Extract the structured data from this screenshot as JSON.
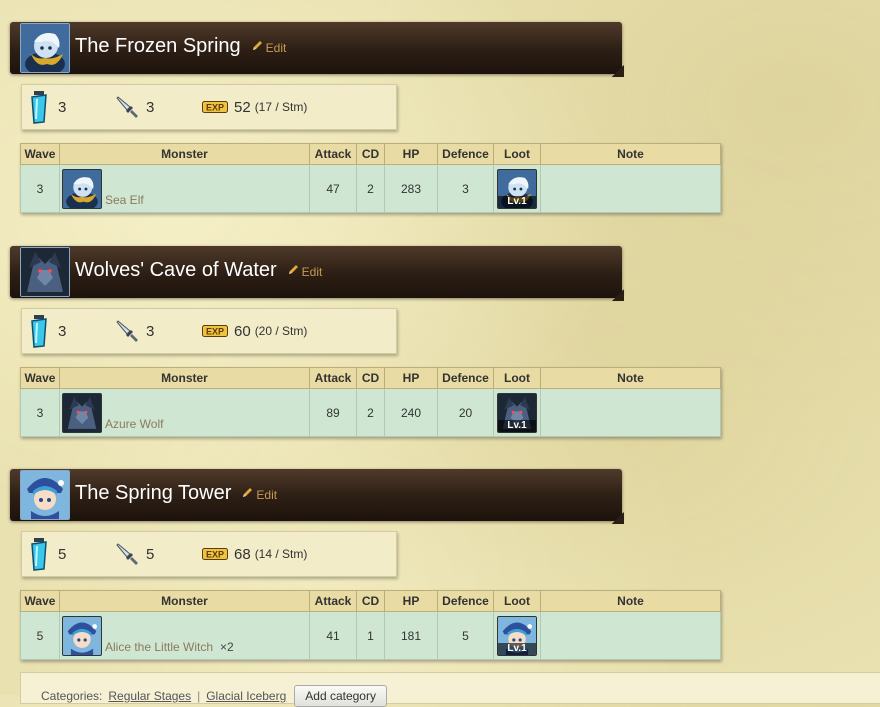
{
  "edit_label": "Edit",
  "columns": [
    "Wave",
    "Monster",
    "Attack",
    "CD",
    "HP",
    "Defence",
    "Loot",
    "Note"
  ],
  "stages": [
    {
      "title": "The Frozen Spring",
      "icon": "sea-elf-icon",
      "stamina": "3",
      "battles": "3",
      "exp": "52",
      "exp_rate": "(17 / Stm)",
      "row": {
        "wave": "3",
        "monster": "Sea Elf",
        "multiplier": "",
        "attack": "47",
        "cd": "2",
        "hp": "283",
        "defence": "3",
        "loot_level": "Lv.1",
        "note": ""
      }
    },
    {
      "title": "Wolves' Cave of Water",
      "icon": "azure-wolf-icon",
      "stamina": "3",
      "battles": "3",
      "exp": "60",
      "exp_rate": "(20 / Stm)",
      "row": {
        "wave": "3",
        "monster": "Azure Wolf",
        "multiplier": "",
        "attack": "89",
        "cd": "2",
        "hp": "240",
        "defence": "20",
        "loot_level": "Lv.1",
        "note": ""
      }
    },
    {
      "title": "The Spring Tower",
      "icon": "little-witch-icon",
      "stamina": "5",
      "battles": "5",
      "exp": "68",
      "exp_rate": "(14 / Stm)",
      "row": {
        "wave": "5",
        "monster": "Alice the Little Witch",
        "multiplier": "×2",
        "attack": "41",
        "cd": "1",
        "hp": "181",
        "defence": "5",
        "loot_level": "Lv.1",
        "note": ""
      }
    }
  ],
  "footer": {
    "categories_label": "Categories:",
    "categories": [
      "Regular Stages",
      "Glacial Iceberg"
    ],
    "add_category_label": "Add category"
  },
  "colors": {
    "header": "#2c1e14",
    "table_header": "#e8dba3",
    "table_row": "#cfe7d2",
    "edit_link": "#c69a55"
  }
}
